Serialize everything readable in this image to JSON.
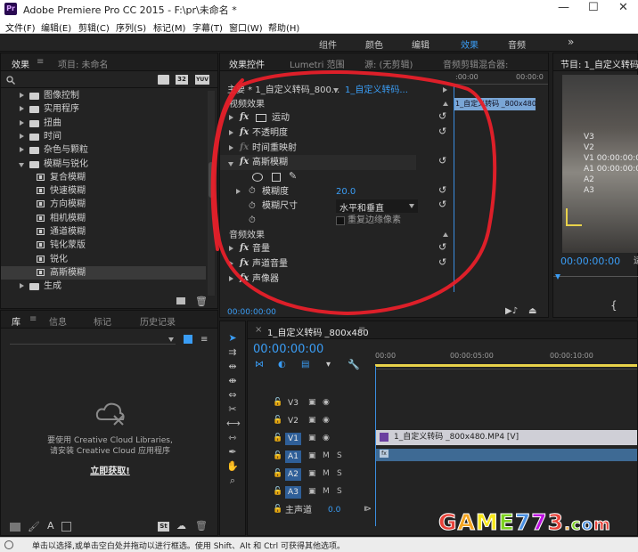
{
  "window": {
    "logo": "Pr",
    "title": "Adobe Premiere Pro CC 2015 - F:\\pr\\未命名 *",
    "minimize": "—",
    "maximize": "☐",
    "close": "✕"
  },
  "menu": [
    "文件(F)",
    "编辑(E)",
    "剪辑(C)",
    "序列(S)",
    "标记(M)",
    "字幕(T)",
    "窗口(W)",
    "帮助(H)"
  ],
  "workspaces": {
    "items": [
      "组件",
      "颜色",
      "编辑",
      "效果",
      "音频"
    ],
    "active": "效果",
    "more": "»"
  },
  "effects_panel": {
    "tabs": [
      "效果",
      "项目: 未命名"
    ],
    "menu_glyph": "≡",
    "search_icon": "search-icon",
    "badges": [
      "32",
      "YUV"
    ],
    "tree": [
      {
        "label": "图像控制",
        "type": "folder",
        "indent": 0,
        "expanded": false
      },
      {
        "label": "实用程序",
        "type": "folder",
        "indent": 0,
        "expanded": false
      },
      {
        "label": "扭曲",
        "type": "folder",
        "indent": 0,
        "expanded": false
      },
      {
        "label": "时间",
        "type": "folder",
        "indent": 0,
        "expanded": false
      },
      {
        "label": "杂色与颗粒",
        "type": "folder",
        "indent": 0,
        "expanded": false
      },
      {
        "label": "模糊与锐化",
        "type": "folder",
        "indent": 0,
        "expanded": true
      },
      {
        "label": "复合模糊",
        "type": "effect",
        "indent": 1
      },
      {
        "label": "快速模糊",
        "type": "effect",
        "indent": 1
      },
      {
        "label": "方向模糊",
        "type": "effect",
        "indent": 1
      },
      {
        "label": "相机模糊",
        "type": "effect",
        "indent": 1
      },
      {
        "label": "通道模糊",
        "type": "effect",
        "indent": 1
      },
      {
        "label": "钝化蒙版",
        "type": "effect",
        "indent": 1
      },
      {
        "label": "锐化",
        "type": "effect",
        "indent": 1
      },
      {
        "label": "高斯模糊",
        "type": "effect",
        "indent": 1,
        "selected": true
      },
      {
        "label": "生成",
        "type": "folder",
        "indent": 0,
        "expanded": false
      }
    ]
  },
  "effect_controls": {
    "tabs": [
      "效果控件",
      "Lumetri 范围",
      "源: (无剪辑)",
      "音频剪辑混合器:"
    ],
    "clip_header": "主要 * 1_自定义转码_800...",
    "clip_sequence": "1_自定义转码...",
    "mini_clip": "1_自定义转码 _800x480",
    "mini_time": "00:00:0",
    "video_section": "视频效果",
    "audio_section": "音频效果",
    "effects": [
      {
        "name": "运动",
        "expanded": false,
        "icon": "motion"
      },
      {
        "name": "不透明度",
        "expanded": false,
        "icon": "fx"
      },
      {
        "name": "时间重映射",
        "expanded": false,
        "icon": "fx-dim"
      },
      {
        "name": "高斯模糊",
        "expanded": true,
        "icon": "fx"
      }
    ],
    "blur_amount_label": "模糊度",
    "blur_amount_value": "20.0",
    "blur_dim_label": "模糊尺寸",
    "blur_dim_value": "水平和垂直",
    "repeat_edge_label": "重复边缘像素",
    "audio_effects": [
      "音量",
      "声道音量",
      "声像器"
    ],
    "timecode": "00:00:00:00"
  },
  "program_monitor": {
    "title": "节目: 1_自定义转码",
    "overlay_lines": [
      "V3",
      "V2",
      "V1 00:00:00:0",
      "A1 00:00:00:0",
      "A2",
      "A3"
    ],
    "timecode": "00:00:00:00",
    "fit_label": "适"
  },
  "libraries_panel": {
    "tabs": [
      "库",
      "信息",
      "标记",
      "历史记录"
    ],
    "message_line1": "要使用 Creative Cloud Libraries,",
    "message_line2": "请安装 Creative Cloud 应用程序",
    "link": "立即获取!",
    "bottom_badge": "St"
  },
  "timeline": {
    "tab": "1_自定义转码 _800x480",
    "close_glyph": "×",
    "timecode": "00:00:00:00",
    "ruler": [
      "00:00",
      "00:00:05:00",
      "00:00:10:00"
    ],
    "tracks": [
      {
        "name": "V3",
        "kind": "video",
        "on": false
      },
      {
        "name": "V2",
        "kind": "video",
        "on": false
      },
      {
        "name": "V1",
        "kind": "video",
        "on": true
      },
      {
        "name": "A1",
        "kind": "audio",
        "on": true
      },
      {
        "name": "A2",
        "kind": "audio",
        "on": true
      },
      {
        "name": "A3",
        "kind": "audio",
        "on": true
      }
    ],
    "master_label": "主声道",
    "master_value": "0.0",
    "video_clip": "1_自定义转码 _800x480.MP4 [V]",
    "audio_clip": "fx",
    "mute_label": "M",
    "solo_label": "S"
  },
  "status_bar": {
    "text": "单击以选择,或单击空白处并拖动以进行框选。使用 Shift、Alt 和 Ctrl 可获得其他选项。"
  },
  "watermark": {
    "text": "GAME773.com",
    "colors": [
      "#e8433a",
      "#f5a623",
      "#f8e71c",
      "#7ed321",
      "#4a90e2",
      "#bd10e0",
      "#e8433a",
      "#f5a623",
      "#7ed321",
      "#4a90e2",
      "#e8433a"
    ]
  },
  "colors": {
    "accent_blue": "#3a9df5",
    "annotation_red": "#e8202a",
    "track_on": "#2f5f98"
  }
}
